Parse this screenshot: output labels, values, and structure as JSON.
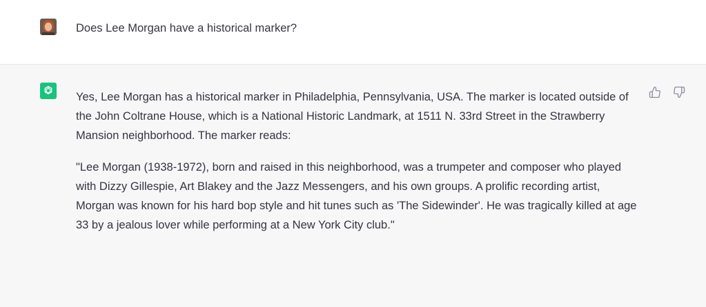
{
  "user_message": {
    "text": "Does Lee Morgan have a historical marker?"
  },
  "assistant_message": {
    "paragraphs": [
      "Yes, Lee Morgan has a historical marker in Philadelphia, Pennsylvania, USA. The marker is located outside of the John Coltrane House, which is a National Historic Landmark, at 1511 N. 33rd Street in the Strawberry Mansion neighborhood. The marker reads:",
      "\"Lee Morgan (1938-1972), born and raised in this neighborhood, was a trumpeter and composer who played with Dizzy Gillespie, Art Blakey and the Jazz Messengers, and his own groups. A prolific recording artist, Morgan was known for his hard bop style and hit tunes such as 'The Sidewinder'. He was tragically killed at age 33 by a jealous lover while performing at a New York City club.\""
    ]
  },
  "feedback": {
    "thumbs_up_icon": "thumbs-up-icon",
    "thumbs_down_icon": "thumbs-down-icon"
  },
  "colors": {
    "assistant_bg": "#f7f7f8",
    "user_bg": "#ffffff",
    "bot_avatar": "#19c37d",
    "text": "#343541"
  }
}
